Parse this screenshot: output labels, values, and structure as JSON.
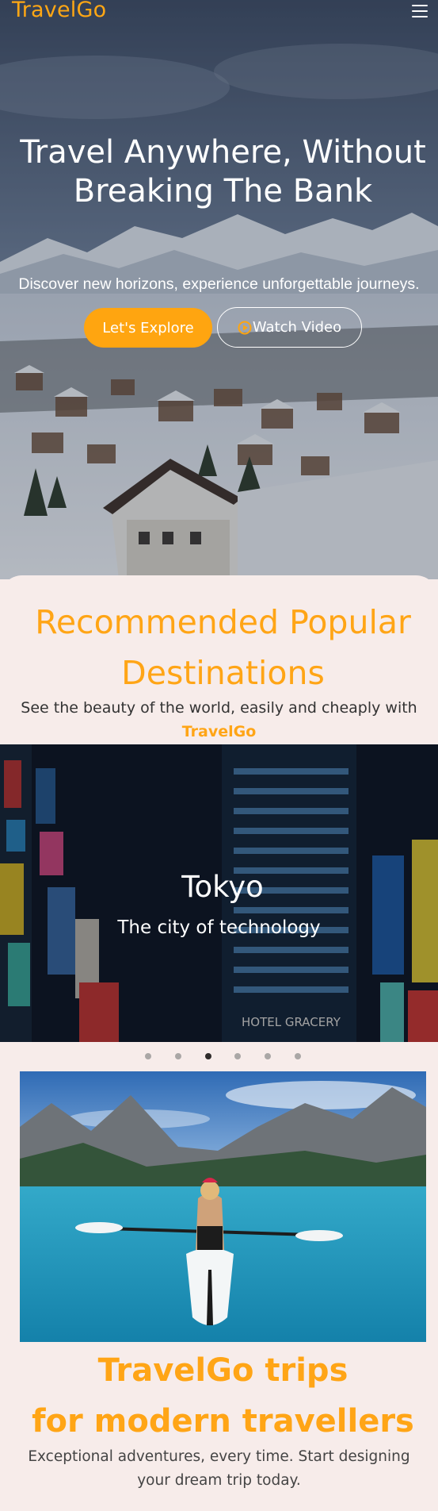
{
  "brand": {
    "name": "TravelGo"
  },
  "colors": {
    "accent": "#ffa516",
    "background": "#f7ecea",
    "active_dot": "#2f2b2a",
    "inactive_dot": "#aaa7a6"
  },
  "header": {
    "menu_icon": "hamburger-menu-icon"
  },
  "hero": {
    "title": "Travel Anywhere, Without Breaking The Bank",
    "subtitle": "Discover new horizons, experience unforgettable journeys.",
    "explore_label": "Let's Explore",
    "video_label": "Watch Video",
    "video_icon": "play-circle-icon"
  },
  "recommended": {
    "title": "Recommended Popular Destinations",
    "subtitle": "See the beauty of the world, easily and cheaply with",
    "brand": "TravelGo"
  },
  "carousel": {
    "slide_title": "Tokyo",
    "slide_subtitle": "The city of technology",
    "sign_text": "HOTEL GRACERY",
    "slide_count": 6,
    "active_index": 2
  },
  "trips": {
    "title_line1": "TravelGo trips",
    "title_line2": "for modern travellers",
    "subtitle": "Exceptional adventures, every time. Start designing your dream trip today."
  }
}
